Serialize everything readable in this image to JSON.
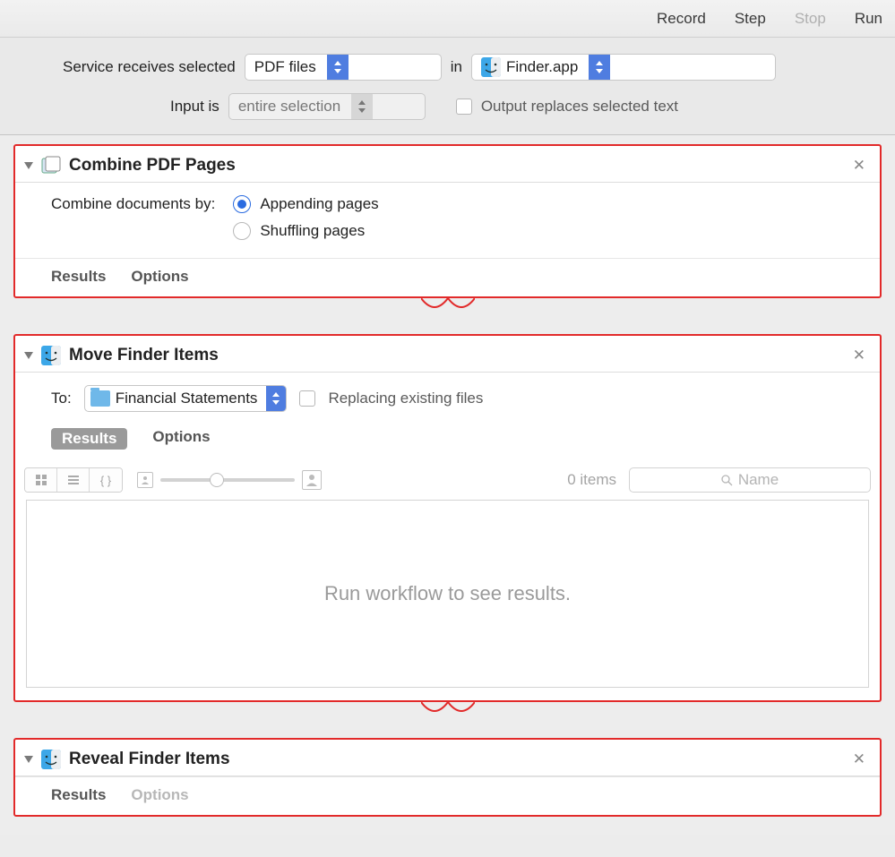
{
  "toolbar": {
    "record": "Record",
    "step": "Step",
    "stop": "Stop",
    "run": "Run"
  },
  "config": {
    "receives_label": "Service receives selected",
    "input_type": "PDF files",
    "in_label": "in",
    "app": "Finder.app",
    "inputis_label": "Input is",
    "inputis_value": "entire selection",
    "output_replace": "Output replaces selected text"
  },
  "actions": {
    "combine": {
      "title": "Combine PDF Pages",
      "combine_by_label": "Combine documents by:",
      "opt_append": "Appending pages",
      "opt_shuffle": "Shuffling pages",
      "results": "Results",
      "options": "Options"
    },
    "move": {
      "title": "Move Finder Items",
      "to_label": "To:",
      "folder": "Financial Statements",
      "replace_label": "Replacing existing files",
      "results": "Results",
      "options": "Options",
      "items_count": "0 items",
      "search_placeholder": "Name",
      "empty_msg": "Run workflow to see results."
    },
    "reveal": {
      "title": "Reveal Finder Items",
      "results": "Results",
      "options": "Options"
    }
  }
}
